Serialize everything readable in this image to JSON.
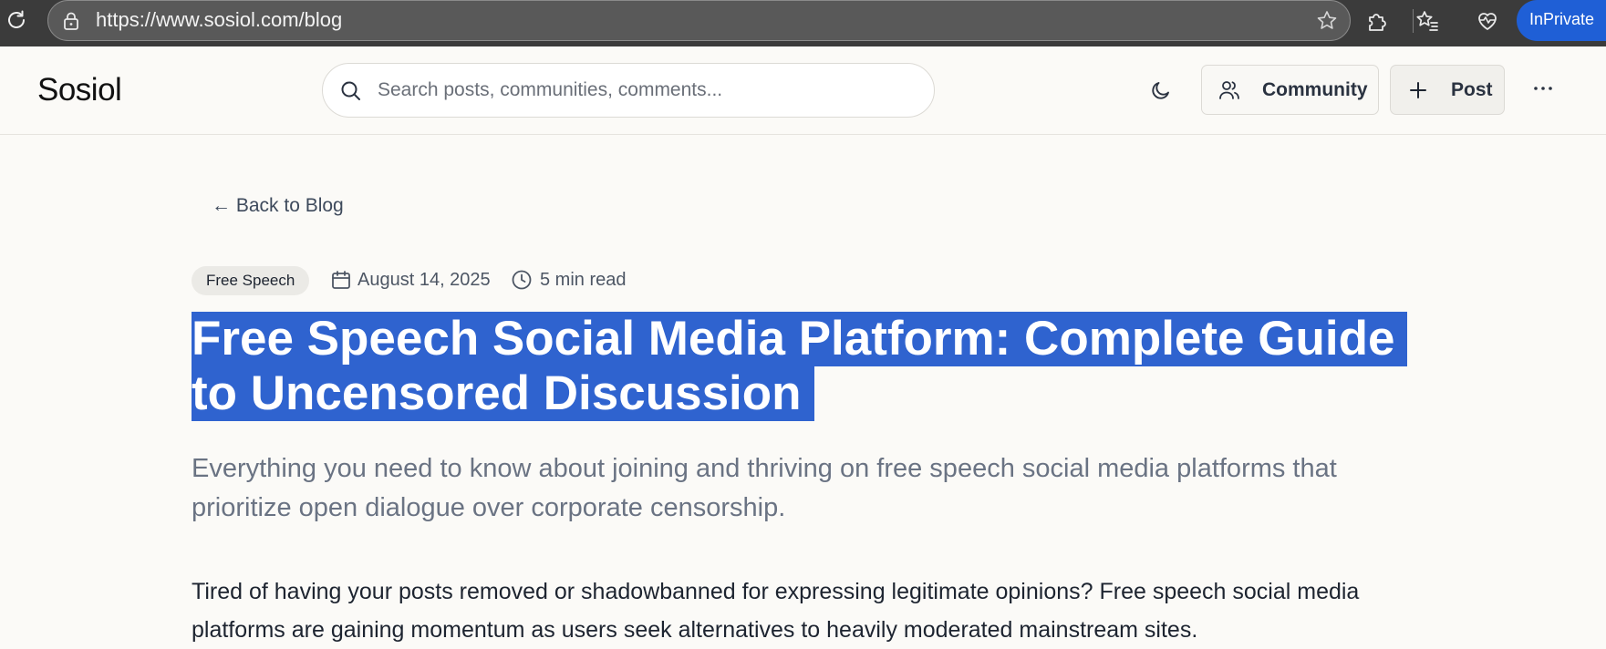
{
  "browser": {
    "url": "https://www.sosiol.com/blog",
    "inprivate_label": "InPrivate"
  },
  "site": {
    "logo": "Sosiol",
    "search_placeholder": "Search posts, communities, comments...",
    "community_label": "Community",
    "post_label": "Post"
  },
  "article": {
    "back_link": "← Back to Blog",
    "category": "Free Speech",
    "date": "August 14, 2025",
    "read_time": "5 min read",
    "title": "Free Speech Social Media Platform: Complete Guide to Uncensored Discussion",
    "subtitle": "Everything you need to know about joining and thriving on free speech social media platforms that prioritize open dialogue over corporate censorship.",
    "body": "Tired of having your posts removed or shadowbanned for expressing legitimate opinions? Free speech social media platforms are gaining momentum as users seek alternatives to heavily moderated mainstream sites."
  },
  "colors": {
    "selection": "#2f63cf",
    "inprivate": "#1f5fd6",
    "page_bg": "#fbfaf7"
  }
}
